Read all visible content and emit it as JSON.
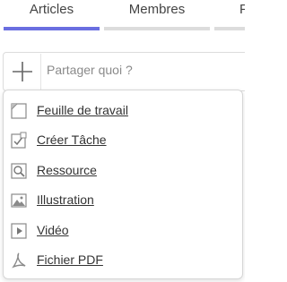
{
  "tabs": [
    {
      "label": "Articles",
      "active": true
    },
    {
      "label": "Membres",
      "active": false
    },
    {
      "label": "F",
      "active": false
    }
  ],
  "composer": {
    "placeholder": "Partager quoi ?",
    "value": ""
  },
  "menu": {
    "items": [
      {
        "label": "Feuille de travail",
        "icon": "worksheet-icon"
      },
      {
        "label": "Créer Tâche",
        "icon": "task-icon"
      },
      {
        "label": "Ressource",
        "icon": "resource-search-icon"
      },
      {
        "label": "Illustration",
        "icon": "image-icon"
      },
      {
        "label": "Vidéo",
        "icon": "video-play-icon"
      },
      {
        "label": "Fichier PDF",
        "icon": "pdf-icon"
      }
    ]
  },
  "colors": {
    "active_tab": "#6a6ee0",
    "inactive_tab": "#dcdcdc",
    "text": "#333333",
    "placeholder": "#8a8a8a"
  }
}
